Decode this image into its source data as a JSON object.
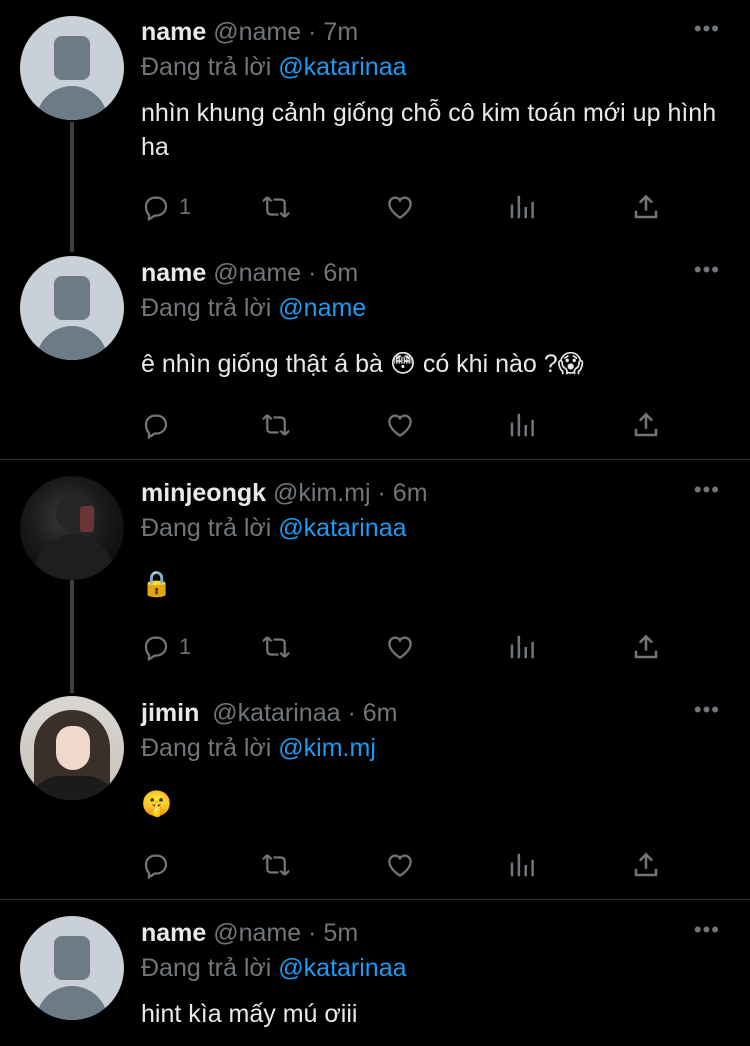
{
  "tweets": [
    {
      "name": "name",
      "handle": "@name",
      "time": "7m",
      "reply_label": "Đang trả lời",
      "reply_to": "@katarinaa",
      "text": "nhìn khung cảnh giống chỗ cô kim toán mới up hình ha",
      "reply_count": "1",
      "avatar": "default-avatar"
    },
    {
      "name": "name",
      "handle": "@name",
      "time": "6m",
      "reply_label": "Đang trả lời",
      "reply_to": "@name",
      "text": "ê nhìn giống thật á bà 😳  có khi nào ?😱",
      "reply_count": "",
      "avatar": "default-avatar"
    },
    {
      "name": "minjeongk",
      "handle": "@kim.mj",
      "time": "6m",
      "reply_label": "Đang trả lời",
      "reply_to": "@katarinaa",
      "text": "🔒",
      "reply_count": "1",
      "avatar": "dark-photo-avatar"
    },
    {
      "name": "jimin",
      "handle": "@katarinaa",
      "time": "6m",
      "reply_label": "Đang trả lời",
      "reply_to": "@kim.mj",
      "text": "🤫",
      "reply_count": "",
      "avatar": "girl-photo-avatar"
    },
    {
      "name": "name",
      "handle": "@name",
      "time": "5m",
      "reply_label": "Đang trả lời",
      "reply_to": "@katarinaa",
      "text": "hint kìa mấy mú ơiii",
      "reply_count": "",
      "avatar": "default-avatar"
    }
  ],
  "separator": "·",
  "more_icon": "•••",
  "icons": {
    "reply": "reply-icon",
    "retweet": "retweet-icon",
    "like": "heart-icon",
    "views": "views-icon",
    "share": "share-icon"
  },
  "colors": {
    "background": "#000000",
    "text": "#e7e9ea",
    "secondary": "#71767b",
    "mention": "#1d9bf0"
  }
}
